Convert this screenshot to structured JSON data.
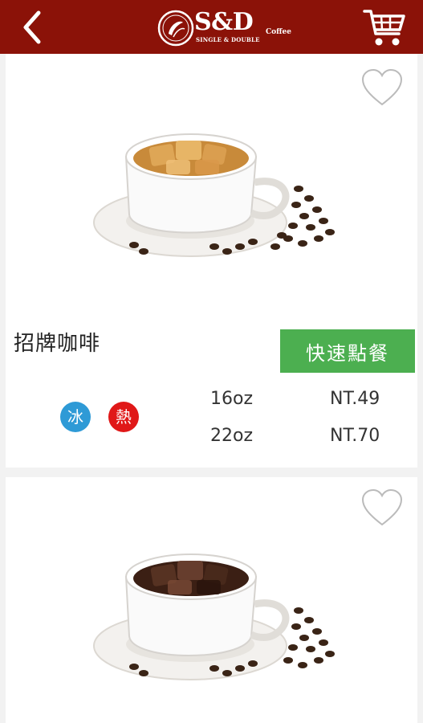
{
  "header": {
    "logo_main": "S&D",
    "logo_sub": "SINGLE & DOUBLE",
    "logo_coffee": "Coffee"
  },
  "icons": {
    "back": "chevron-left",
    "cart": "shopping-cart",
    "favorite": "heart-outline"
  },
  "colors": {
    "header_bg": "#8b1208",
    "order_button": "#4caf50",
    "ice_badge": "#2e9ad6",
    "hot_badge": "#e01818"
  },
  "products": [
    {
      "name": "招牌咖啡",
      "order_label": "快速點餐",
      "ice_label": "冰",
      "hot_label": "熱",
      "sizes": [
        {
          "size": "16oz",
          "price": "NT.49"
        },
        {
          "size": "22oz",
          "price": "NT.70"
        }
      ],
      "image": "latte-with-ice"
    },
    {
      "image": "black-coffee-with-ice"
    }
  ]
}
